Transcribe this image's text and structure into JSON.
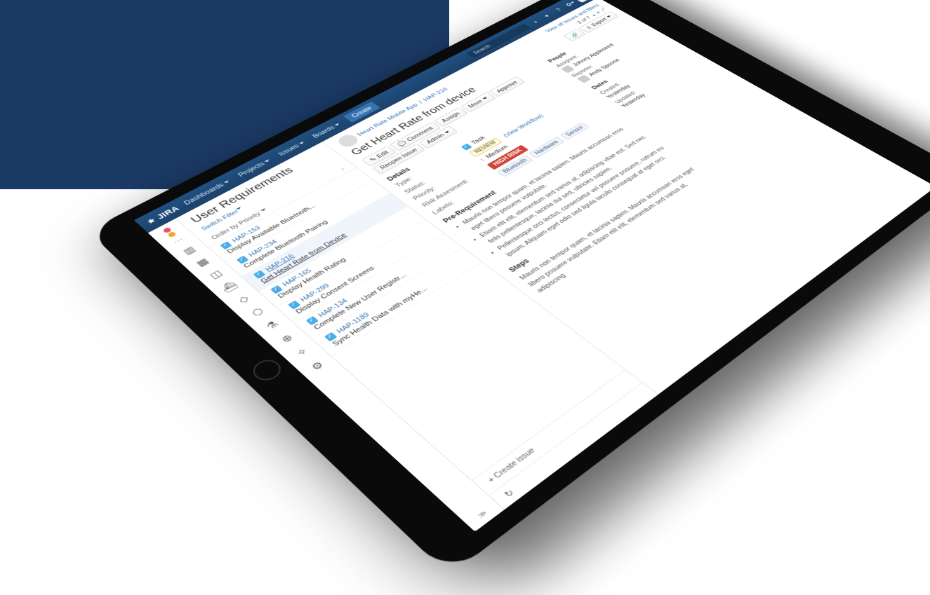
{
  "header": {
    "logo": "JIRA",
    "nav": [
      "Dashboards",
      "Projects",
      "Issues",
      "Boards"
    ],
    "create": "Create",
    "search_placeholder": "Search"
  },
  "page": {
    "title": "User Requirements",
    "switch_filter": "Switch Filter",
    "order_by": "Order by Priority",
    "create_issue": "+ Create issue"
  },
  "issues": [
    {
      "key": "HAP-153",
      "summary": "Display Available Bluetooth..."
    },
    {
      "key": "HAP-234",
      "summary": "Complete Bluetooth Pairing"
    },
    {
      "key": "HAP-216",
      "summary": "Get Heart Rate from Device",
      "selected": true
    },
    {
      "key": "HAP-165",
      "summary": "Display Health Rating"
    },
    {
      "key": "HAP-299",
      "summary": "Display Consent Screens"
    },
    {
      "key": "HAP-134",
      "summary": "Complete New User Registr..."
    },
    {
      "key": "HAP-1189",
      "summary": "Sync Health Data with myHe..."
    }
  ],
  "detail": {
    "view_all": "View all issues and filters",
    "counter": "3 of 7",
    "project": "Heart Rate Mobile App",
    "key": "HAP-216",
    "title": "Get Heart Rate from device",
    "toolbar": {
      "edit": "Edit",
      "comment": "Comment",
      "assign": "Assign",
      "more": "More",
      "approve": "Approve",
      "reopen": "Reopen Issue",
      "admin": "Admin",
      "share": "Share",
      "export": "Export"
    },
    "sections": {
      "details": "Details",
      "prereq": "Pre-Requirement",
      "steps": "Steps"
    },
    "fields": {
      "type_label": "Type:",
      "type_value": "Task",
      "status_label": "Status:",
      "status_value": "REVIEW",
      "workflow": "(View Workflow)",
      "priority_label": "Priority:",
      "priority_value": "Medium",
      "risk_label": "Risk Assesment:",
      "risk_value": "HIGH RISK",
      "labels_label": "Labels:",
      "labels": [
        "Bluetooth",
        "Hardware",
        "Sensor"
      ]
    },
    "prereq_bullets": [
      "Mauris non tempor quam, et lacinia sapien. Mauris accumsan eros eget libero posuere vulputate.",
      "Etiam elit elit, elementum sed varius at, adipiscing vitae est. Sed nec felis pellentesque, lacinia dui sed, ultricies sapien.",
      "Pellentesque orci lectus, consectetur vel posuere posuere, rutrum eu ipsum. Aliquam eget odio sed ligula iaculis consequat at eget orci."
    ],
    "steps_text": "Mauris non tempor quam, et lacinia sapien. Mauris accumsan eros eget libero posuere vulputate. Etiam elit elit, elementum sed varius at, adipiscing"
  },
  "side": {
    "people_h": "People",
    "assignee_label": "Assignee:",
    "assignee": "Johnny Appleseed",
    "reporter_label": "Reporter:",
    "reporter": "Andy Spoone",
    "dates_h": "Dates",
    "created_label": "Created:",
    "created": "Yesterday",
    "updated_label": "Updated:",
    "updated": "Yesterday"
  }
}
